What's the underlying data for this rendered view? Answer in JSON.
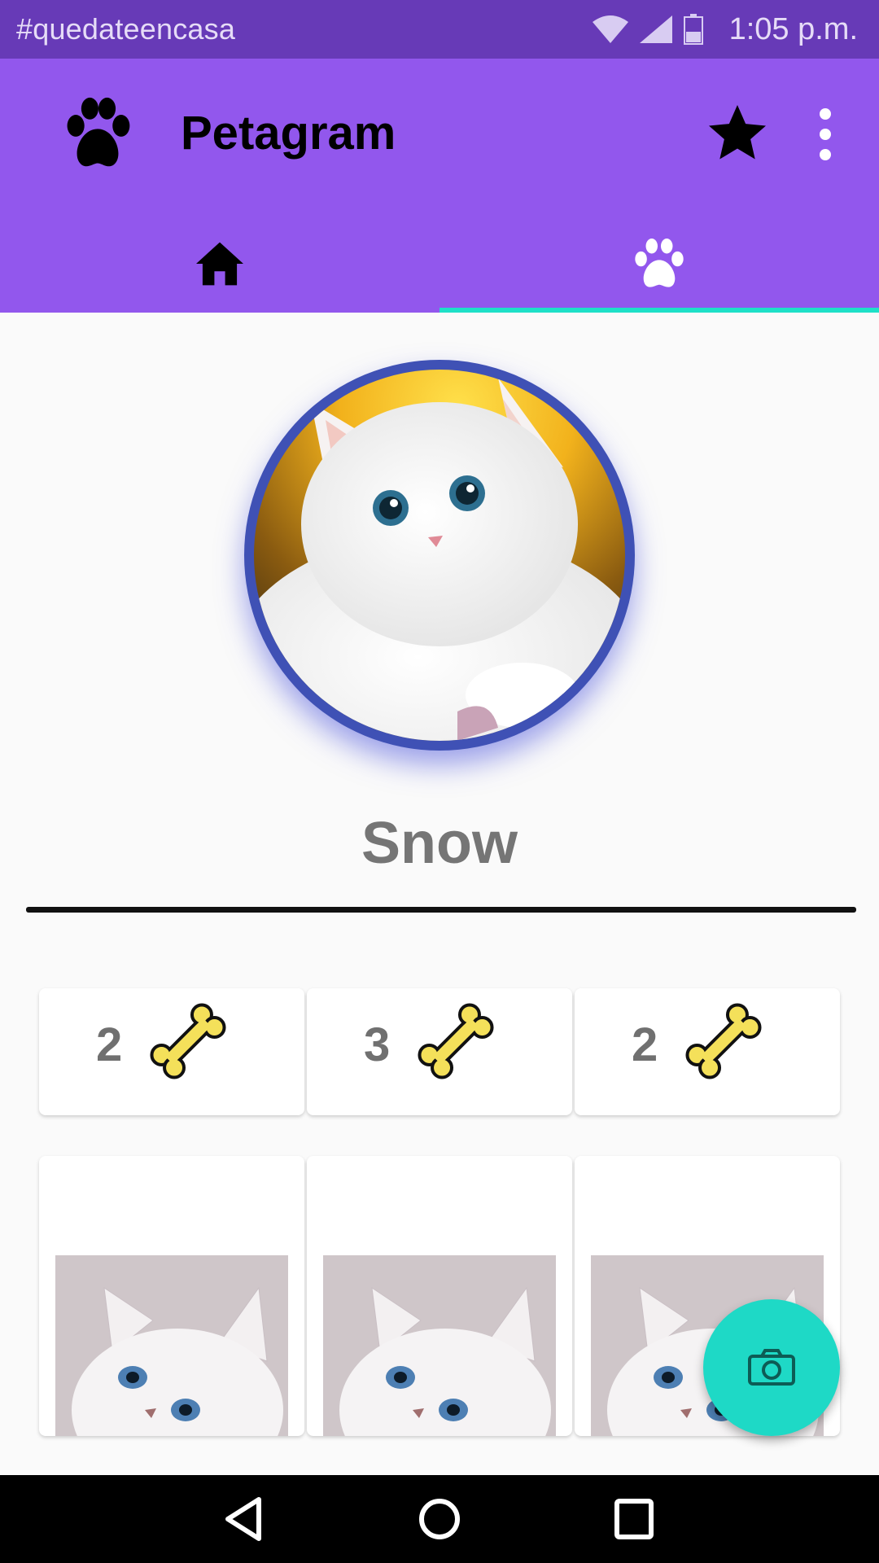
{
  "status_bar": {
    "carrier_text": "#quedateencasa",
    "time": "1:05 p.m.",
    "icons": [
      "wifi-icon",
      "signal-icon",
      "battery-icon"
    ]
  },
  "app_bar": {
    "title": "Petagram",
    "logo_icon": "paw-icon",
    "actions": [
      "star-icon",
      "overflow-menu-icon"
    ],
    "tabs": [
      {
        "icon": "home-icon",
        "selected": false
      },
      {
        "icon": "paw-icon",
        "selected": true
      }
    ]
  },
  "profile": {
    "name": "Snow"
  },
  "likes": [
    {
      "count": "2",
      "icon": "bone-icon"
    },
    {
      "count": "3",
      "icon": "bone-icon"
    },
    {
      "count": "2",
      "icon": "bone-icon"
    }
  ],
  "fab": {
    "icon": "camera-icon"
  },
  "navigation": [
    "back-icon",
    "home-circle-icon",
    "recents-icon"
  ],
  "colors": {
    "status_bar": "#673ab7",
    "app_bar": "#9257ed",
    "tab_indicator": "#1ee0c8",
    "fab": "#1ed9c6",
    "avatar_ring": "#3f51b5"
  }
}
